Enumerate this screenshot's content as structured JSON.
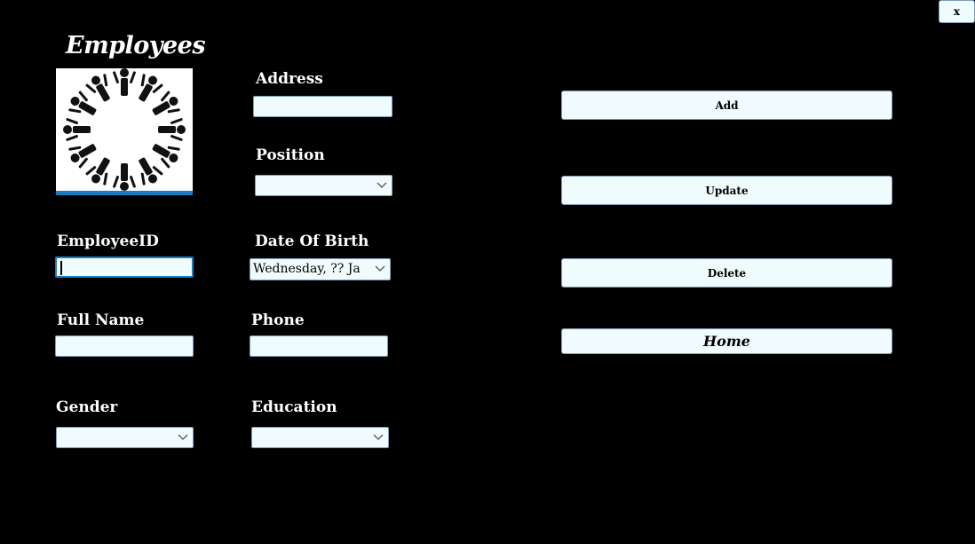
{
  "window": {
    "close_label": "x"
  },
  "header": {
    "title": "Employees"
  },
  "form": {
    "address_label": "Address",
    "address_value": "",
    "position_label": "Position",
    "position_value": "",
    "employee_id_label": "EmployeeID",
    "employee_id_value": "",
    "dob_label": "Date Of Birth",
    "dob_value": "Wednesday, ?? Ja",
    "full_name_label": "Full Name",
    "full_name_value": "",
    "phone_label": "Phone",
    "phone_value": "",
    "gender_label": "Gender",
    "gender_value": "",
    "education_label": "Education",
    "education_value": ""
  },
  "actions": {
    "add_label": "Add",
    "update_label": "Update",
    "delete_label": "Delete",
    "home_label": "Home"
  },
  "colors": {
    "background": "#000000",
    "field_fill": "#f0fbfd",
    "logo_bar": "#1a7bbf"
  }
}
